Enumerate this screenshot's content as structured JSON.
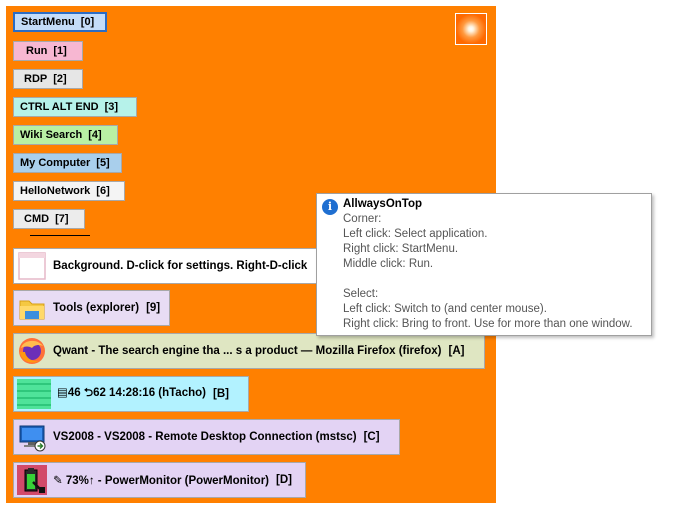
{
  "launcher": {
    "buttons": [
      {
        "label": "StartMenu",
        "key": "[0]",
        "bg": "#c4dcf8",
        "border": "#2b6cc4"
      },
      {
        "label": "Run",
        "key": "[1]",
        "bg": "#f7b7d2",
        "border": "#a8a8a8"
      },
      {
        "label": "RDP",
        "key": "[2]",
        "bg": "#e6e6e6",
        "border": "#a8a8a8"
      },
      {
        "label": "CTRL ALT END",
        "key": "[3]",
        "bg": "#b6f2ea",
        "border": "#a8a8a8"
      },
      {
        "label": "Wiki Search",
        "key": "[4]",
        "bg": "#b9f0a4",
        "border": "#a8a8a8"
      },
      {
        "label": "My Computer",
        "key": "[5]",
        "bg": "#a9cfec",
        "border": "#a8a8a8"
      },
      {
        "label": "HelloNetwork",
        "key": "[6]",
        "bg": "#f4f4f4",
        "border": "#a8a8a8"
      },
      {
        "label": "CMD",
        "key": "[7]",
        "bg": "#ececec",
        "border": "#a8a8a8"
      }
    ],
    "windows": [
      {
        "label": "Background. D-click for settings. Right-D-click",
        "key": "",
        "bg": "#ffffff",
        "icon": "blank-window-icon"
      },
      {
        "label": "Tools (explorer)",
        "key": "[9]",
        "bg": "#e8dcf4",
        "icon": "folder-icon"
      },
      {
        "label": "Qwant - The search engine tha ... s a product — Mozilla Firefox (firefox)",
        "key": "[A]",
        "bg": "#dfe6c2",
        "icon": "firefox-icon"
      },
      {
        "label": "▤46 ⮌62 14:28:16 (hTacho)",
        "key": "[B]",
        "bg": "#b2f2ff",
        "icon": "tacho-icon"
      },
      {
        "label": "VS2008 - VS2008 - Remote Desktop Connection (mstsc)",
        "key": "[C]",
        "bg": "#e3d3f4",
        "icon": "remote-desktop-icon"
      },
      {
        "label": "✎ 73%↑ - PowerMonitor (PowerMonitor)",
        "key": "[D]",
        "bg": "#e3d3f4",
        "icon": "battery-icon"
      }
    ]
  },
  "tooltip": {
    "title": "AllwaysOnTop",
    "lines": [
      "Corner:",
      "Left click: Select application.",
      "Right click: StartMenu.",
      "Middle click: Run.",
      "",
      "Select:",
      "Left click: Switch to (and center mouse).",
      "Right click: Bring to front. Use for more than one window."
    ]
  },
  "colors": {
    "panel": "#ff8000",
    "accent": "#1f6fd1"
  }
}
